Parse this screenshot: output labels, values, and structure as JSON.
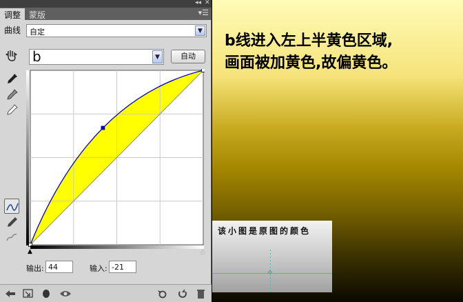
{
  "panel": {
    "tabs": [
      {
        "label": "调整",
        "active": true
      },
      {
        "label": "蒙版",
        "active": false
      }
    ],
    "preset": {
      "label": "曲线",
      "value": "自定"
    },
    "channel": {
      "value": "b"
    },
    "auto_label": "自动",
    "output": {
      "label": "输出:",
      "value": "44"
    },
    "input": {
      "label": "输入:",
      "value": "-21"
    },
    "curve": {
      "points": [
        [
          0,
          0
        ],
        [
          42,
          67
        ],
        [
          100,
          100
        ]
      ],
      "fill_color": "#ffff00",
      "point_color": "#0000cc"
    }
  },
  "annotation": {
    "lines": [
      "b线进入左上半黄色区域,",
      "画面被加黄色,故偏黄色。"
    ]
  },
  "thumbnail": {
    "caption": "该小图是原图的颜色"
  },
  "colors": {
    "accent_yellow": "#ffff00",
    "curve_blue": "#0000cc",
    "panel_bg": "#d6d6d6"
  }
}
